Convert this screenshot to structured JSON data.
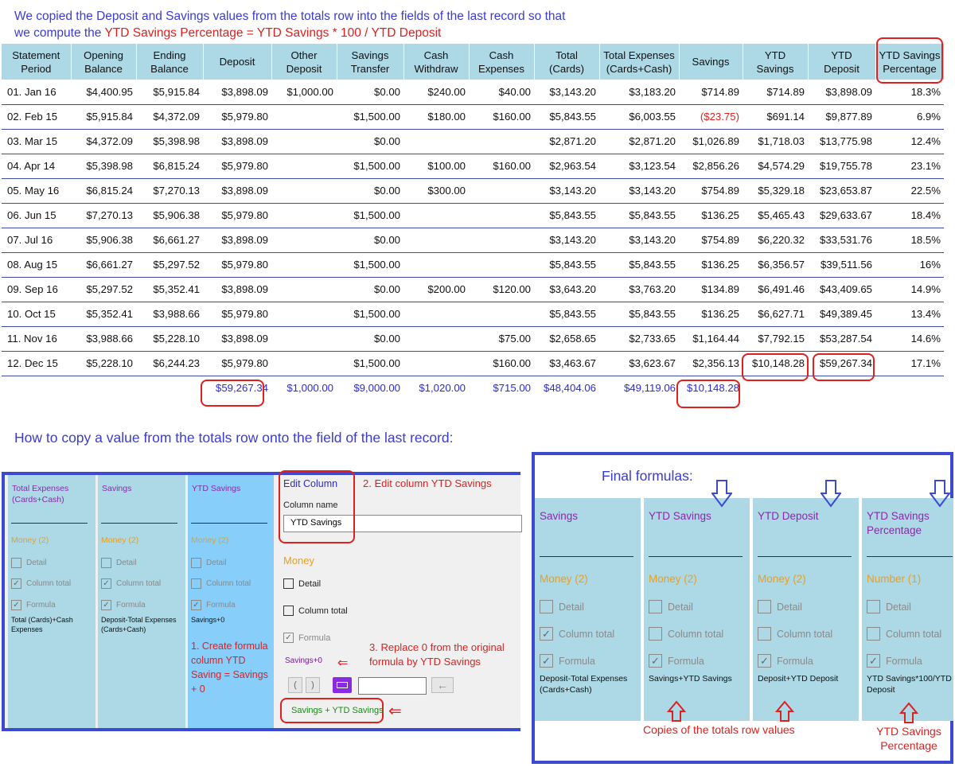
{
  "intro": {
    "line1": "We copied the Deposit and Savings values from the totals row into the fields of the last record so that",
    "line2_prefix": "we compute the ",
    "line2_formula": "YTD Savings Percentage = YTD Savings * 100 / YTD Deposit"
  },
  "table": {
    "headers": [
      [
        "Statement",
        "Period"
      ],
      [
        "Opening",
        "Balance"
      ],
      [
        "Ending",
        "Balance"
      ],
      [
        "Deposit"
      ],
      [
        "Other",
        "Deposit"
      ],
      [
        "Savings",
        "Transfer"
      ],
      [
        "Cash",
        "Withdraw"
      ],
      [
        "Cash",
        "Expenses"
      ],
      [
        "Total",
        "(Cards)"
      ],
      [
        "Total Expenses",
        "(Cards+Cash)"
      ],
      [
        "Savings"
      ],
      [
        "YTD",
        "Savings"
      ],
      [
        "YTD",
        "Deposit"
      ],
      [
        "YTD Savings",
        "Percentage"
      ]
    ],
    "rows": [
      [
        "01. Jan 16",
        "$4,400.95",
        "$5,915.84",
        "$3,898.09",
        "$1,000.00",
        "$0.00",
        "$240.00",
        "$40.00",
        "$3,143.20",
        "$3,183.20",
        "$714.89",
        "$714.89",
        "$3,898.09",
        "18.3%"
      ],
      [
        "02. Feb 15",
        "$5,915.84",
        "$4,372.09",
        "$5,979.80",
        "",
        "$1,500.00",
        "$180.00",
        "$160.00",
        "$5,843.55",
        "$6,003.55",
        "($23.75)",
        "$691.14",
        "$9,877.89",
        "6.9%"
      ],
      [
        "03. Mar 15",
        "$4,372.09",
        "$5,398.98",
        "$3,898.09",
        "",
        "$0.00",
        "",
        "",
        "$2,871.20",
        "$2,871.20",
        "$1,026.89",
        "$1,718.03",
        "$13,775.98",
        "12.4%"
      ],
      [
        "04. Apr 14",
        "$5,398.98",
        "$6,815.24",
        "$5,979.80",
        "",
        "$1,500.00",
        "$100.00",
        "$160.00",
        "$2,963.54",
        "$3,123.54",
        "$2,856.26",
        "$4,574.29",
        "$19,755.78",
        "23.1%"
      ],
      [
        "05. May 16",
        "$6,815.24",
        "$7,270.13",
        "$3,898.09",
        "",
        "$0.00",
        "$300.00",
        "",
        "$3,143.20",
        "$3,143.20",
        "$754.89",
        "$5,329.18",
        "$23,653.87",
        "22.5%"
      ],
      [
        "06. Jun 15",
        "$7,270.13",
        "$5,906.38",
        "$5,979.80",
        "",
        "$1,500.00",
        "",
        "",
        "$5,843.55",
        "$5,843.55",
        "$136.25",
        "$5,465.43",
        "$29,633.67",
        "18.4%"
      ],
      [
        "07. Jul 16",
        "$5,906.38",
        "$6,661.27",
        "$3,898.09",
        "",
        "$0.00",
        "",
        "",
        "$3,143.20",
        "$3,143.20",
        "$754.89",
        "$6,220.32",
        "$33,531.76",
        "18.5%"
      ],
      [
        "08. Aug 15",
        "$6,661.27",
        "$5,297.52",
        "$5,979.80",
        "",
        "$1,500.00",
        "",
        "",
        "$5,843.55",
        "$5,843.55",
        "$136.25",
        "$6,356.57",
        "$39,511.56",
        "16%"
      ],
      [
        "09. Sep 16",
        "$5,297.52",
        "$5,352.41",
        "$3,898.09",
        "",
        "$0.00",
        "$200.00",
        "$120.00",
        "$3,643.20",
        "$3,763.20",
        "$134.89",
        "$6,491.46",
        "$43,409.65",
        "14.9%"
      ],
      [
        "10. Oct 15",
        "$5,352.41",
        "$3,988.66",
        "$5,979.80",
        "",
        "$1,500.00",
        "",
        "",
        "$5,843.55",
        "$5,843.55",
        "$136.25",
        "$6,627.71",
        "$49,389.45",
        "13.4%"
      ],
      [
        "11. Nov 16",
        "$3,988.66",
        "$5,228.10",
        "$3,898.09",
        "",
        "$0.00",
        "",
        "$75.00",
        "$2,658.65",
        "$2,733.65",
        "$1,164.44",
        "$7,792.15",
        "$53,287.54",
        "14.6%"
      ],
      [
        "12. Dec 15",
        "$5,228.10",
        "$6,244.23",
        "$5,979.80",
        "",
        "$1,500.00",
        "",
        "$160.00",
        "$3,463.67",
        "$3,623.67",
        "$2,356.13",
        "$10,148.28",
        "$59,267.34",
        "17.1%"
      ]
    ],
    "totals": [
      "",
      "",
      "",
      "$59,267.34",
      "$1,000.00",
      "$9,000.00",
      "$1,020.00",
      "$715.00",
      "$48,404.06",
      "$49,119.06",
      "$10,148.28",
      "",
      "",
      ""
    ]
  },
  "howto_heading": "How to copy a value from the totals row onto the field of the last record:",
  "left_panel": {
    "columns": [
      {
        "title": "Total Expenses (Cards+Cash)",
        "type": "Money (2)",
        "formula": "Total (Cards)+Cash Expenses"
      },
      {
        "title": "Savings",
        "type": "Money (2)",
        "formula": "Deposit-Total Expenses (Cards+Cash)"
      },
      {
        "title": "YTD Savings",
        "type": "Money (2)",
        "formula": "Savings+0"
      }
    ],
    "opt_detail": "Detail",
    "opt_column_total": "Column total",
    "opt_formula": "Formula",
    "edit": {
      "title": "Edit Column",
      "column_name_label": "Column name",
      "column_name_value": "YTD Savings",
      "type": "Money",
      "detail": "Detail",
      "column_total": "Column total",
      "formula": "Formula",
      "formula_text": "Savings+0",
      "paren_open": "(",
      "paren_close": ")",
      "result": "Savings + YTD Savings"
    },
    "notes": {
      "step1": "1. Create formula column YTD Saving = Savings + 0",
      "step2": "2. Edit column YTD Savings",
      "step3": "3. Replace 0 from the original formula by YTD Savings"
    }
  },
  "right_panel": {
    "title": "Final formulas:",
    "columns": [
      {
        "title": "Savings",
        "type": "Money (2)",
        "formula": "Deposit-Total Expenses (Cards+Cash)",
        "total_checked": true
      },
      {
        "title": "YTD Savings",
        "type": "Money (2)",
        "formula": "Savings+YTD Savings",
        "total_checked": false
      },
      {
        "title": "YTD Deposit",
        "type": "Money (2)",
        "formula": "Deposit+YTD Deposit",
        "total_checked": false
      },
      {
        "title": "YTD Savings Percentage",
        "type": "Number (1)",
        "formula": "YTD Savings*100/YTD Deposit",
        "total_checked": false
      }
    ],
    "opt_detail": "Detail",
    "opt_column_total": "Column total",
    "opt_formula": "Formula",
    "note_copies": "Copies of the totals row values",
    "note_pct": "YTD Savings Percentage"
  },
  "colors": {
    "header_bg": "#add8e6",
    "accent_blue": "#3b3bd6",
    "annotation_red": "#e0201e",
    "totals_blue": "#2a2ae0",
    "title_purple": "#8a2aa8",
    "type_orange": "#e8a020"
  }
}
